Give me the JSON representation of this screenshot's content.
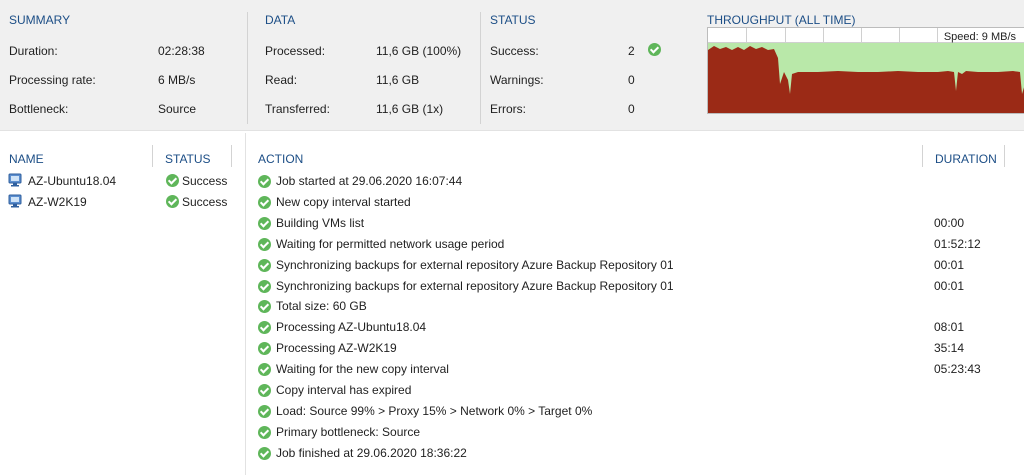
{
  "summary": {
    "title": "SUMMARY",
    "rows": [
      {
        "label": "Duration:",
        "value": "02:28:38"
      },
      {
        "label": "Processing rate:",
        "value": "6 MB/s"
      },
      {
        "label": "Bottleneck:",
        "value": "Source"
      }
    ]
  },
  "data": {
    "title": "DATA",
    "rows": [
      {
        "label": "Processed:",
        "value": "11,6 GB (100%)"
      },
      {
        "label": "Read:",
        "value": "11,6 GB"
      },
      {
        "label": "Transferred:",
        "value": "11,6 GB (1x)"
      }
    ]
  },
  "status": {
    "title": "STATUS",
    "rows": [
      {
        "label": "Success:",
        "value": "2"
      },
      {
        "label": "Warnings:",
        "value": "0"
      },
      {
        "label": "Errors:",
        "value": "0"
      }
    ]
  },
  "throughput": {
    "title": "THROUGHPUT (ALL TIME)",
    "speed": "Speed: 9 MB/s",
    "colors": {
      "area": "#9b2a16",
      "bg": "#b9e8a9",
      "grid": "#d0d0d0"
    }
  },
  "vms": {
    "name_header": "NAME",
    "status_header": "STATUS",
    "items": [
      {
        "name": "AZ-Ubuntu18.04",
        "status": "Success",
        "icon": "vm-icon"
      },
      {
        "name": "AZ-W2K19",
        "status": "Success",
        "icon": "vm-icon"
      }
    ]
  },
  "actions": {
    "action_header": "ACTION",
    "duration_header": "DURATION",
    "items": [
      {
        "text": "Job started at 29.06.2020 16:07:44",
        "duration": ""
      },
      {
        "text": "New copy interval started",
        "duration": ""
      },
      {
        "text": "Building VMs list",
        "duration": "00:00"
      },
      {
        "text": "Waiting for permitted network usage period",
        "duration": "01:52:12"
      },
      {
        "text": "Synchronizing backups for external repository Azure Backup Repository 01",
        "duration": "00:01"
      },
      {
        "text": "Synchronizing backups for external repository Azure Backup Repository 01",
        "duration": "00:01"
      },
      {
        "text": "Total size: 60 GB",
        "duration": ""
      },
      {
        "text": "Processing AZ-Ubuntu18.04",
        "duration": "08:01"
      },
      {
        "text": "Processing AZ-W2K19",
        "duration": "35:14"
      },
      {
        "text": "Waiting for the new copy interval",
        "duration": "05:23:43"
      },
      {
        "text": "Copy interval has expired",
        "duration": ""
      },
      {
        "text": "Load: Source 99% > Proxy 15% > Network 0% > Target 0%",
        "duration": ""
      },
      {
        "text": "Primary bottleneck: Source",
        "duration": ""
      },
      {
        "text": "Job finished at 29.06.2020 18:36:22",
        "duration": ""
      }
    ]
  }
}
